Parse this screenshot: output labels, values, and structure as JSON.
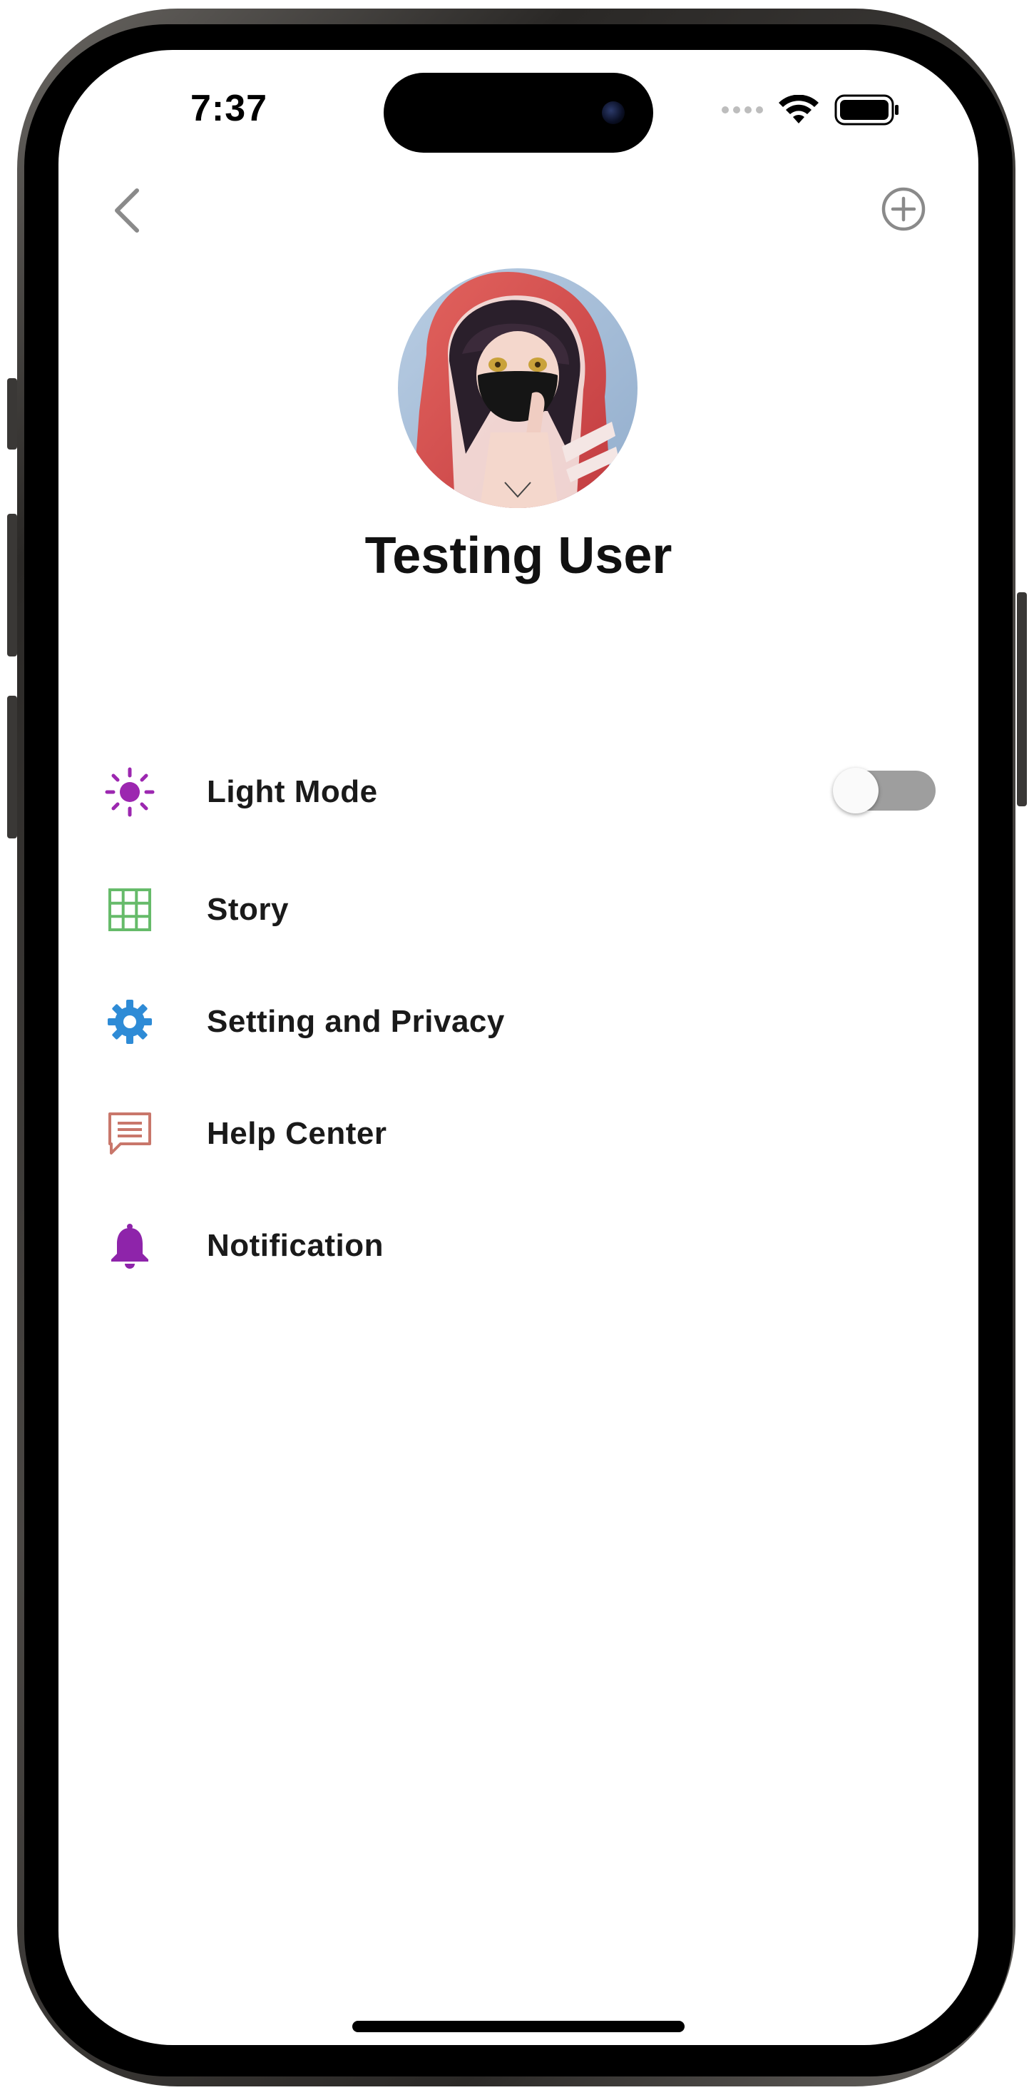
{
  "status_bar": {
    "time": "7:37"
  },
  "nav": {
    "back_icon": "chevron-left-icon",
    "add_icon": "plus-circle-icon"
  },
  "profile": {
    "name": "Testing User",
    "avatar": "anime-avatar"
  },
  "menu": {
    "items": [
      {
        "label": "Light Mode",
        "icon": "sun-icon",
        "icon_color": "#9c27b0",
        "has_toggle": true,
        "toggle_on": false
      },
      {
        "label": "Story",
        "icon": "grid-icon",
        "icon_color": "#66bb6a"
      },
      {
        "label": "Setting and Privacy",
        "icon": "gear-icon",
        "icon_color": "#2e8bd6"
      },
      {
        "label": "Help Center",
        "icon": "chat-icon",
        "icon_color": "#c9776b"
      },
      {
        "label": "Notification",
        "icon": "bell-icon",
        "icon_color": "#8e24aa"
      }
    ]
  }
}
